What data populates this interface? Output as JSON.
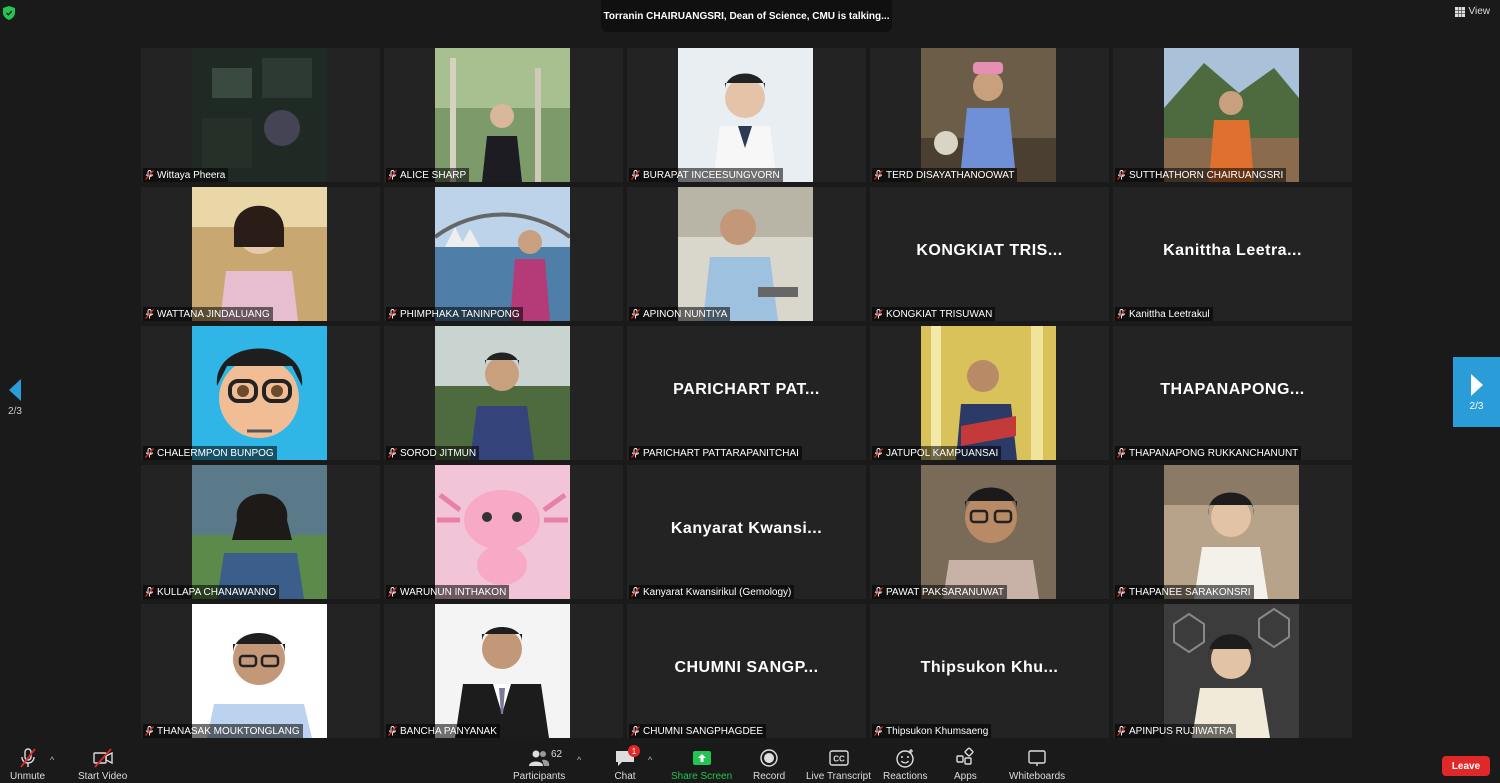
{
  "top": {
    "speaker_banner": "Torranin CHAIRUANGSRI, Dean of Science, CMU is talking...",
    "view_label": "View"
  },
  "pagination": {
    "left": "2/3",
    "right": "2/3"
  },
  "tiles": [
    {
      "name": "Wittaya Pheera",
      "big": "",
      "photo": "dark",
      "bg": "#1f2a24"
    },
    {
      "name": "ALICE SHARP",
      "big": "",
      "photo": "trees",
      "bg": "#6f8a5e"
    },
    {
      "name": "BURAPAT INCEESUNGVORN",
      "big": "",
      "photo": "lab",
      "bg": "#e9eef2"
    },
    {
      "name": "TERD DISAYATHANOOWAT",
      "big": "",
      "photo": "blue-shirt",
      "bg": "#6b5d48"
    },
    {
      "name": "SUTTHATHORN CHAIRUANGSRI",
      "big": "",
      "photo": "mountain",
      "bg": "#8a9a6a"
    },
    {
      "name": "WATTANA JINDALUANG",
      "big": "",
      "photo": "pink",
      "bg": "#c8a870"
    },
    {
      "name": "PHIMPHAKA TANINPONG",
      "big": "",
      "photo": "harbour",
      "bg": "#7fa3c9"
    },
    {
      "name": "APINON NUNTIYA",
      "big": "",
      "photo": "office",
      "bg": "#d9d6cc"
    },
    {
      "name": "KONGKIAT TRISUWAN",
      "big": "KONGKIAT  TRIS...",
      "photo": "",
      "bg": ""
    },
    {
      "name": "Kanittha  Leetrakul",
      "big": "Kanittha  Leetra...",
      "photo": "",
      "bg": ""
    },
    {
      "name": "CHALERMPON BUNPOG",
      "big": "",
      "photo": "avatar",
      "bg": "#2fb5e6"
    },
    {
      "name": "SOROD JITMUN",
      "big": "",
      "photo": "garden",
      "bg": "#4e6b3f"
    },
    {
      "name": "PARICHART PATTARAPANITCHAI",
      "big": "PARICHART  PAT...",
      "photo": "",
      "bg": ""
    },
    {
      "name": "JATUPOL KAMPUANSAI",
      "big": "",
      "photo": "yellow",
      "bg": "#d9c25a"
    },
    {
      "name": "THAPANAPONG RUKKANCHANUNT",
      "big": "THAPANAPONG...",
      "photo": "",
      "bg": ""
    },
    {
      "name": "KULLAPA CHANAWANNO",
      "big": "",
      "photo": "park",
      "bg": "#5a7a8a"
    },
    {
      "name": "WARUNUN INTHAKON",
      "big": "",
      "photo": "axolotl",
      "bg": "#f2c4d8"
    },
    {
      "name": "Kanyarat Kwansirikul (Gemology)",
      "big": "Kanyarat  Kwansi...",
      "photo": "",
      "bg": ""
    },
    {
      "name": "PAWAT PAKSARANUWAT",
      "big": "",
      "photo": "stone",
      "bg": "#7a6a58"
    },
    {
      "name": "THAPANEE SARAKONSRI",
      "big": "",
      "photo": "lab2",
      "bg": "#b7a38a"
    },
    {
      "name": "THANASAK MOUKTONGLANG",
      "big": "",
      "photo": "white",
      "bg": "#ffffff"
    },
    {
      "name": "BANCHA PANYANAK",
      "big": "",
      "photo": "suit",
      "bg": "#f4f4f4"
    },
    {
      "name": "CHUMNI SANGPHAGDEE",
      "big": "CHUMNI  SANGP...",
      "photo": "",
      "bg": ""
    },
    {
      "name": "Thipsukon Khumsaeng",
      "big": "Thipsukon  Khu...",
      "photo": "",
      "bg": ""
    },
    {
      "name": "APINPUS RUJIWATRA",
      "big": "",
      "photo": "chem",
      "bg": "#3c3c3c"
    }
  ],
  "toolbar": {
    "unmute": "Unmute",
    "start_video": "Start Video",
    "participants": "Participants",
    "participants_count": "62",
    "chat": "Chat",
    "chat_badge": "1",
    "share_screen": "Share Screen",
    "record": "Record",
    "live_transcript": "Live Transcript",
    "reactions": "Reactions",
    "apps": "Apps",
    "whiteboards": "Whiteboards",
    "leave": "Leave",
    "cc_text": "CC"
  },
  "colors": {
    "accent_blue": "#2a9dd8",
    "share_green": "#23c552",
    "leave_red": "#e02828",
    "mute_red": "#e02828"
  }
}
